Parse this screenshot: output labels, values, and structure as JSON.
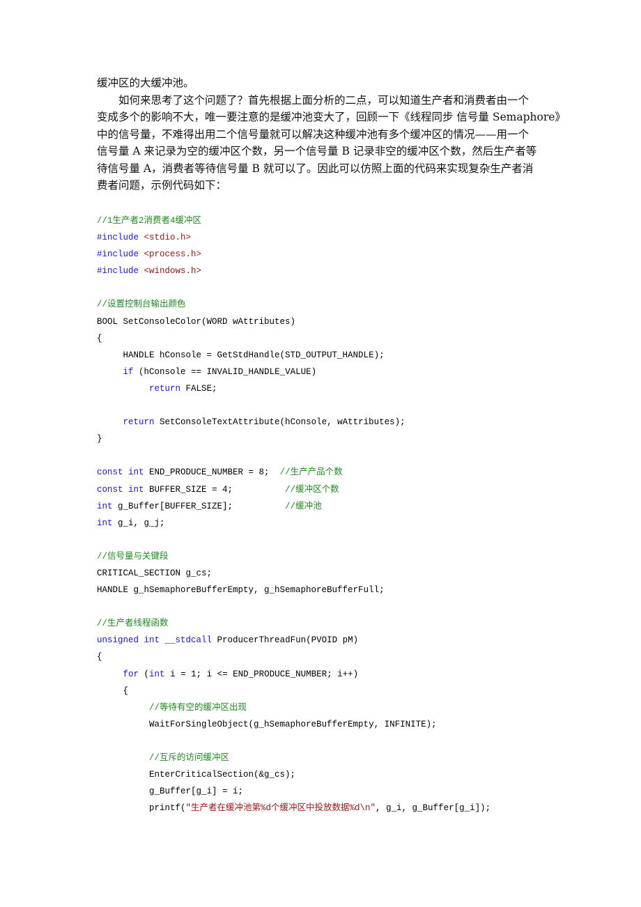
{
  "paragraphs": [
    {
      "indent": false,
      "text": "缓冲区的大缓冲池。"
    },
    {
      "indent": true,
      "text": "如何来思考了这个问题了？首先根据上面分析的二点，可以知道生产者和消费者由一个"
    },
    {
      "indent": false,
      "text": "变成多个的影响不大，唯一要注意的是缓冲池变大了，回顾一下《线程同步 信号量 Semaphore》"
    },
    {
      "indent": false,
      "text": "中的信号量，不难得出用二个信号量就可以解决这种缓冲池有多个缓冲区的情况——用一个"
    },
    {
      "indent": false,
      "text": "信号量 A 来记录为空的缓冲区个数，另一个信号量 B 记录非空的缓冲区个数，然后生产者等"
    },
    {
      "indent": false,
      "text": "待信号量 A，消费者等待信号量 B 就可以了。因此可以仿照上面的代码来实现复杂生产者消"
    },
    {
      "indent": false,
      "text": "费者问题，示例代码如下："
    }
  ],
  "code_lines": [
    [
      {
        "t": "cm",
        "s": "//1生产者2消费者4缓冲区"
      }
    ],
    [
      {
        "t": "kw",
        "s": "#include "
      },
      {
        "t": "str",
        "s": "<stdio.h>"
      }
    ],
    [
      {
        "t": "kw",
        "s": "#include "
      },
      {
        "t": "str",
        "s": "<process.h>"
      }
    ],
    [
      {
        "t": "kw",
        "s": "#include "
      },
      {
        "t": "str",
        "s": "<windows.h>"
      }
    ],
    [],
    [
      {
        "t": "cm",
        "s": "//设置控制台输出颜色"
      }
    ],
    [
      {
        "t": "",
        "s": "BOOL SetConsoleColor(WORD wAttributes)"
      }
    ],
    [
      {
        "t": "",
        "s": "{"
      }
    ],
    [
      {
        "t": "",
        "s": "     HANDLE hConsole = GetStdHandle(STD_OUTPUT_HANDLE);"
      }
    ],
    [
      {
        "t": "",
        "s": "     "
      },
      {
        "t": "kw",
        "s": "if"
      },
      {
        "t": "",
        "s": " (hConsole == INVALID_HANDLE_VALUE)"
      }
    ],
    [
      {
        "t": "",
        "s": "          "
      },
      {
        "t": "kw",
        "s": "return"
      },
      {
        "t": "",
        "s": " FALSE;"
      }
    ],
    [],
    [
      {
        "t": "",
        "s": "     "
      },
      {
        "t": "kw",
        "s": "return"
      },
      {
        "t": "",
        "s": " SetConsoleTextAttribute(hConsole, wAttributes);"
      }
    ],
    [
      {
        "t": "",
        "s": "}"
      }
    ],
    [],
    [
      {
        "t": "kw",
        "s": "const int"
      },
      {
        "t": "",
        "s": " END_PRODUCE_NUMBER = 8;  "
      },
      {
        "t": "cm",
        "s": "//生产产品个数"
      }
    ],
    [
      {
        "t": "kw",
        "s": "const int"
      },
      {
        "t": "",
        "s": " BUFFER_SIZE = 4;          "
      },
      {
        "t": "cm",
        "s": "//缓冲区个数"
      }
    ],
    [
      {
        "t": "kw",
        "s": "int"
      },
      {
        "t": "",
        "s": " g_Buffer[BUFFER_SIZE];          "
      },
      {
        "t": "cm",
        "s": "//缓冲池"
      }
    ],
    [
      {
        "t": "kw",
        "s": "int"
      },
      {
        "t": "",
        "s": " g_i, g_j;"
      }
    ],
    [],
    [
      {
        "t": "cm",
        "s": "//信号量与关键段"
      }
    ],
    [
      {
        "t": "",
        "s": "CRITICAL_SECTION g_cs;"
      }
    ],
    [
      {
        "t": "",
        "s": "HANDLE g_hSemaphoreBufferEmpty, g_hSemaphoreBufferFull;"
      }
    ],
    [],
    [
      {
        "t": "cm",
        "s": "//生产者线程函数"
      }
    ],
    [
      {
        "t": "kw",
        "s": "unsigned int"
      },
      {
        "t": "",
        "s": " "
      },
      {
        "t": "kw",
        "s": "__stdcall"
      },
      {
        "t": "",
        "s": " ProducerThreadFun(PVOID pM)"
      }
    ],
    [
      {
        "t": "",
        "s": "{"
      }
    ],
    [
      {
        "t": "",
        "s": "     "
      },
      {
        "t": "kw",
        "s": "for"
      },
      {
        "t": "",
        "s": " ("
      },
      {
        "t": "kw",
        "s": "int"
      },
      {
        "t": "",
        "s": " i = 1; i <= END_PRODUCE_NUMBER; i++)"
      }
    ],
    [
      {
        "t": "",
        "s": "     {"
      }
    ],
    [
      {
        "t": "",
        "s": "          "
      },
      {
        "t": "cm",
        "s": "//等待有空的缓冲区出现"
      }
    ],
    [
      {
        "t": "",
        "s": "          WaitForSingleObject(g_hSemaphoreBufferEmpty, INFINITE);"
      }
    ],
    [],
    [
      {
        "t": "",
        "s": "          "
      },
      {
        "t": "cm",
        "s": "//互斥的访问缓冲区"
      }
    ],
    [
      {
        "t": "",
        "s": "          EnterCriticalSection(&g_cs);"
      }
    ],
    [
      {
        "t": "",
        "s": "          g_Buffer[g_i] = i;"
      }
    ],
    [
      {
        "t": "",
        "s": "          printf("
      },
      {
        "t": "str",
        "s": "\"生产者在缓冲池第%d个缓冲区中投放数据%d\\n\""
      },
      {
        "t": "",
        "s": ", g_i, g_Buffer[g_i]);"
      }
    ]
  ],
  "colors": {
    "keyword": "#1515e0",
    "comment": "#1f8a1f",
    "string": "#a31515",
    "text": "#000000"
  }
}
